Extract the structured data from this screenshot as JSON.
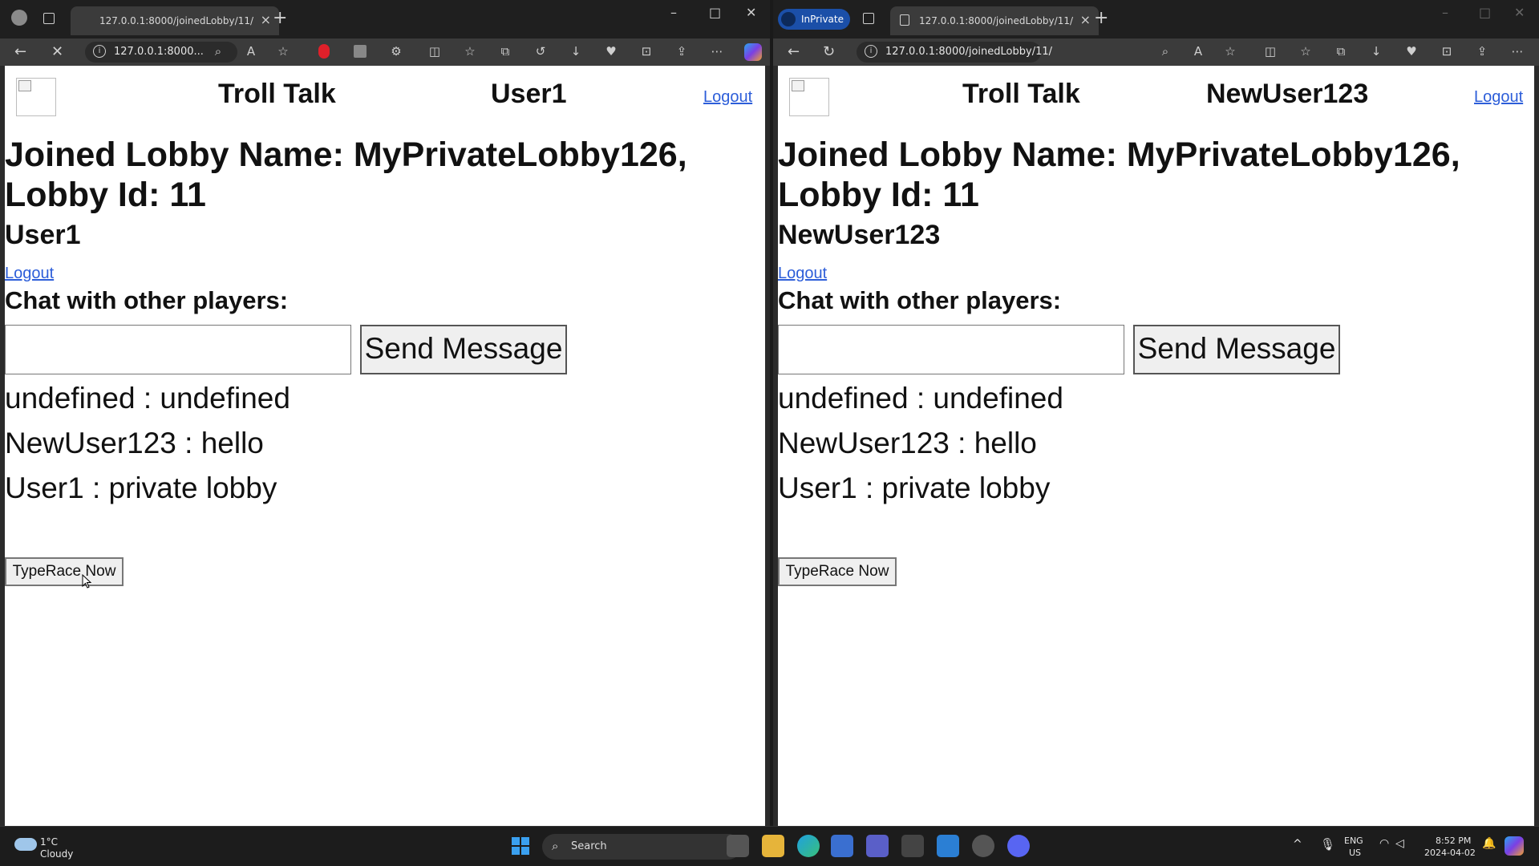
{
  "left": {
    "tab_title": "127.0.0.1:8000/joinedLobby/11/",
    "url": "127.0.0.1:8000...",
    "site_title": "Troll Talk",
    "header_user": "User1",
    "top_logout": "Logout",
    "lobby_heading": "Joined Lobby Name: MyPrivateLobby126, Lobby Id: 11",
    "username": "User1",
    "logout": "Logout",
    "chat_label": "Chat with other players:",
    "input_value": "",
    "send_label": "Send Message",
    "messages": [
      "undefined : undefined",
      "NewUser123 : hello",
      "User1 : private lobby"
    ],
    "typerace_label": "TypeRace Now"
  },
  "right": {
    "inprivate_label": "InPrivate",
    "tab_title": "127.0.0.1:8000/joinedLobby/11/",
    "url": "127.0.0.1:8000/joinedLobby/11/",
    "site_title": "Troll Talk",
    "header_user": "NewUser123",
    "top_logout": "Logout",
    "lobby_heading": "Joined Lobby Name: MyPrivateLobby126, Lobby Id: 11",
    "username": "NewUser123",
    "logout": "Logout",
    "chat_label": "Chat with other players:",
    "input_value": "",
    "send_label": "Send Message",
    "messages": [
      "undefined : undefined",
      "NewUser123 : hello",
      "User1 : private lobby"
    ],
    "typerace_label": "TypeRace Now"
  },
  "taskbar": {
    "weather_temp": "1°C",
    "weather_desc": "Cloudy",
    "search_label": "Search",
    "lang_top": "ENG",
    "lang_bottom": "US",
    "time": "8:52 PM",
    "date": "2024-04-02"
  },
  "colors": {
    "link": "#2d5ed9",
    "browser_dark": "#2b2b2b",
    "inprivate": "#1b4fa8"
  },
  "icons": {
    "browser": [
      "back-icon",
      "stop-icon",
      "refresh-icon",
      "info-icon",
      "zoom-icon",
      "read-aloud-icon",
      "favorite-icon",
      "split-screen-icon",
      "favorites-icon",
      "collections-icon",
      "history-icon",
      "download-icon",
      "performance-icon",
      "screenshot-icon",
      "share-icon",
      "more-icon",
      "copilot-icon"
    ],
    "window": [
      "minimize-icon",
      "maximize-icon",
      "close-icon"
    ]
  }
}
